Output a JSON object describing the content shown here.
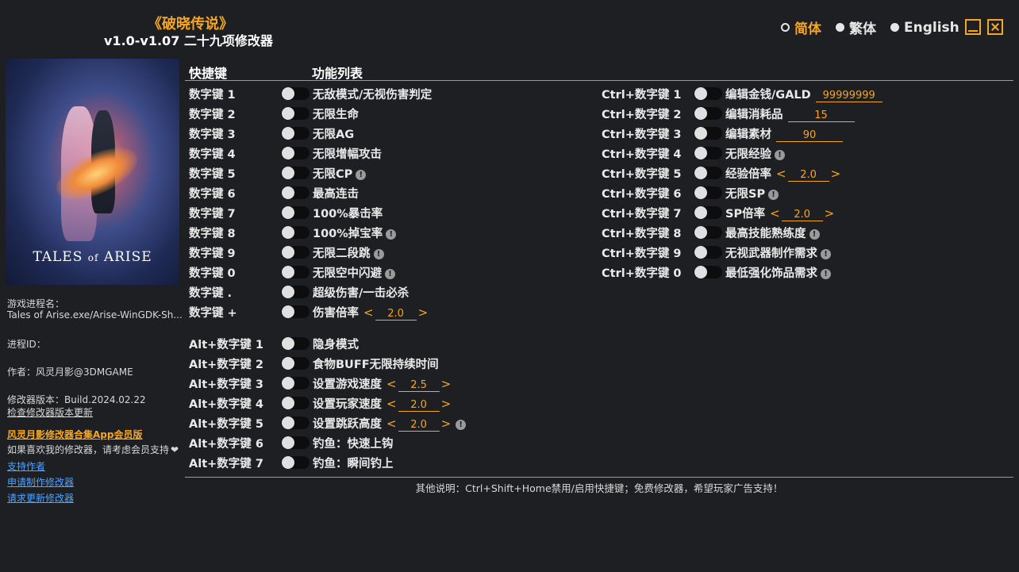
{
  "header": {
    "game_title": "《破晓传说》",
    "subtitle": "v1.0-v1.07 二十九项修改器"
  },
  "languages": [
    "简体",
    "繁体",
    "English"
  ],
  "sidebar": {
    "process_label": "游戏进程名：",
    "process_value": "Tales of Arise.exe/Arise-WinGDK-Sh...",
    "pid_label": "进程ID：",
    "author": "作者：风灵月影@3DMGAME",
    "version": "修改器版本：Build.2024.02.22",
    "check_update": "检查修改器版本更新",
    "vip_app": "风灵月影修改器合集App会员版",
    "support_text": "如果喜欢我的修改器，请考虑会员支持",
    "heart": "❤",
    "support_author": "支持作者",
    "request_trainer": "申请制作修改器",
    "request_update": "请求更新修改器",
    "cover_logo": "TALES of ARISE"
  },
  "columns": {
    "hotkey": "快捷键",
    "features": "功能列表"
  },
  "left_rows": [
    {
      "key": "数字键 1",
      "label": "无敌模式/无视伤害判定"
    },
    {
      "key": "数字键 2",
      "label": "无限生命"
    },
    {
      "key": "数字键 3",
      "label": "无限AG"
    },
    {
      "key": "数字键 4",
      "label": "无限增幅攻击"
    },
    {
      "key": "数字键 5",
      "label": "无限CP",
      "info": "!"
    },
    {
      "key": "数字键 6",
      "label": "最高连击"
    },
    {
      "key": "数字键 7",
      "label": "100%暴击率"
    },
    {
      "key": "数字键 8",
      "label": "100%掉宝率",
      "info": "!"
    },
    {
      "key": "数字键 9",
      "label": "无限二段跳",
      "info": "!"
    },
    {
      "key": "数字键 0",
      "label": "无限空中闪避",
      "info": "!"
    },
    {
      "key": "数字键 .",
      "label": "超级伤害/一击必杀"
    },
    {
      "key": "数字键 +",
      "label": "伤害倍率",
      "value": "2.0"
    }
  ],
  "alt_rows": [
    {
      "key": "Alt+数字键 1",
      "label": "隐身模式"
    },
    {
      "key": "Alt+数字键 2",
      "label": "食物BUFF无限持续时间"
    },
    {
      "key": "Alt+数字键 3",
      "label": "设置游戏速度",
      "value": "2.5"
    },
    {
      "key": "Alt+数字键 4",
      "label": "设置玩家速度",
      "value": "2.0"
    },
    {
      "key": "Alt+数字键 5",
      "label": "设置跳跃高度",
      "value": "2.0",
      "info": "!"
    },
    {
      "key": "Alt+数字键 6",
      "label": "钓鱼：快速上钩"
    },
    {
      "key": "Alt+数字键 7",
      "label": "钓鱼：瞬间钓上"
    }
  ],
  "ctrl_rows": [
    {
      "key": "Ctrl+数字键 1",
      "label": "编辑金钱/GALD",
      "edit": "99999999"
    },
    {
      "key": "Ctrl+数字键 2",
      "label": "编辑消耗品",
      "edit": "15"
    },
    {
      "key": "Ctrl+数字键 3",
      "label": "编辑素材",
      "edit": "90"
    },
    {
      "key": "Ctrl+数字键 4",
      "label": "无限经验",
      "info": "!"
    },
    {
      "key": "Ctrl+数字键 5",
      "label": "经验倍率",
      "value": "2.0"
    },
    {
      "key": "Ctrl+数字键 6",
      "label": "无限SP",
      "info": "!"
    },
    {
      "key": "Ctrl+数字键 7",
      "label": "SP倍率",
      "value": "2.0"
    },
    {
      "key": "Ctrl+数字键 8",
      "label": "最高技能熟练度",
      "info": "!"
    },
    {
      "key": "Ctrl+数字键 9",
      "label": "无视武器制作需求",
      "info": "!"
    },
    {
      "key": "Ctrl+数字键 0",
      "label": "最低强化饰品需求",
      "info": "!"
    }
  ],
  "footer": "其他说明：Ctrl+Shift+Home禁用/启用快捷键；免费修改器，希望玩家广告支持！",
  "colors": {
    "accent": "#f5a623",
    "link": "#4da3ff",
    "background": "#1e1f22"
  }
}
